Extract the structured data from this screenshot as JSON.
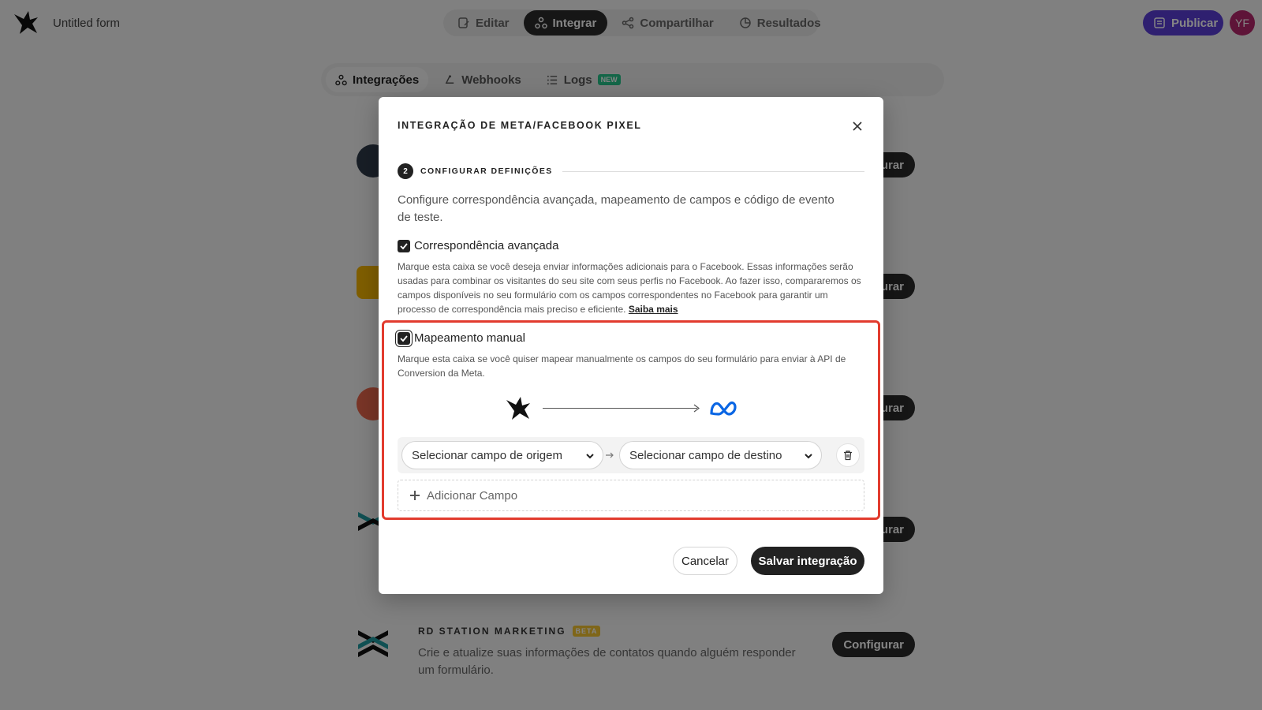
{
  "app": {
    "form_title": "Untitled form",
    "avatar_initials": "YF",
    "publish_label": "Publicar",
    "brand_color": "#5a3fd6"
  },
  "main_tabs": [
    {
      "label": "Editar",
      "icon": "edit-icon",
      "active": false
    },
    {
      "label": "Integrar",
      "icon": "integrate-icon",
      "active": true
    },
    {
      "label": "Compartilhar",
      "icon": "share-icon",
      "active": false
    },
    {
      "label": "Resultados",
      "icon": "results-icon",
      "active": false
    }
  ],
  "sub_tabs": [
    {
      "label": "Integrações",
      "icon": "integrations-icon",
      "active": true
    },
    {
      "label": "Webhooks",
      "icon": "webhook-icon",
      "active": false
    },
    {
      "label": "Logs",
      "icon": "list-icon",
      "active": false,
      "badge": "NEW"
    }
  ],
  "integrations": {
    "config_label": "urar",
    "config_full_label": "Configurar",
    "rd_station": {
      "title": "RD STATION MARKETING",
      "badge": "BETA",
      "description": "Crie e atualize suas informações de contatos quando alguém responder um formulário."
    }
  },
  "modal": {
    "title": "INTEGRAÇÃO DE META/FACEBOOK PIXEL",
    "step_number": "2",
    "step_label": "CONFIGURAR DEFINIÇÕES",
    "intro": "Configure correspondência avançada, mapeamento de campos e código de evento de teste.",
    "advanced_matching": {
      "label": "Correspondência avançada",
      "checked": true,
      "description": "Marque esta caixa se você deseja enviar informações adicionais para o Facebook. Essas informações serão usadas para combinar os visitantes do seu site com seus perfis no Facebook. Ao fazer isso, compararemos os campos disponíveis no seu formulário com os campos correspondentes no Facebook para garantir um processo de correspondência mais preciso e eficiente.",
      "link": "Saiba mais"
    },
    "manual_mapping": {
      "label": "Mapeamento manual",
      "checked": true,
      "description": "Marque esta caixa se você quiser mapear manualmente os campos do seu formulário para enviar à API de Conversion da Meta."
    },
    "source_select": "Selecionar campo de origem",
    "target_select": "Selecionar campo de destino",
    "add_field": "Adicionar Campo",
    "cancel": "Cancelar",
    "save": "Salvar integração",
    "highlight_color": "#e23b2e"
  }
}
